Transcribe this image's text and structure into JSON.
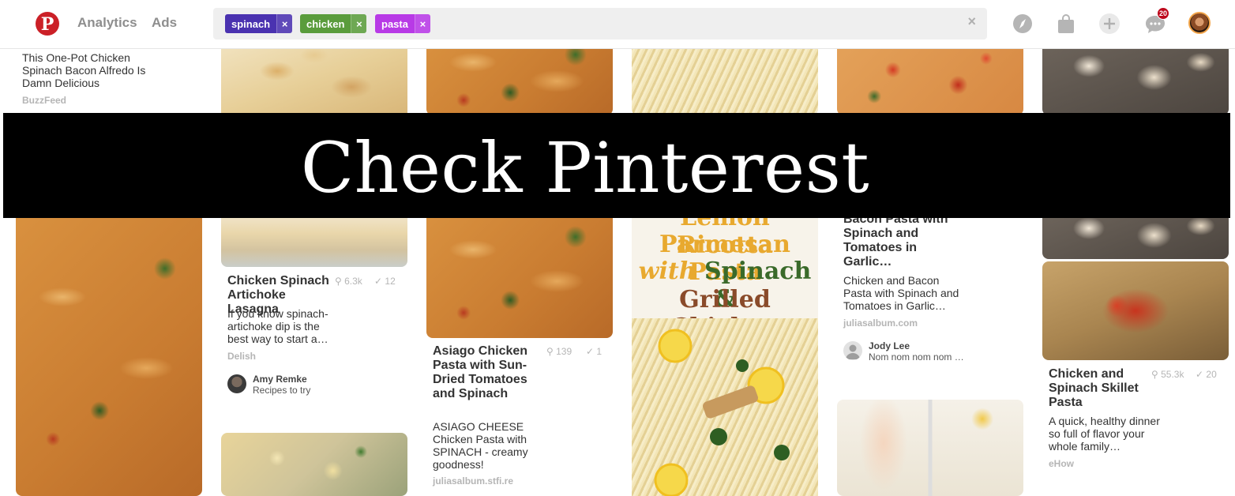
{
  "header": {
    "logo_glyph": "P",
    "nav": {
      "analytics": "Analytics",
      "ads": "Ads"
    },
    "search": {
      "chips": [
        {
          "label": "spinach",
          "remove": "×",
          "color": "#4a32b0"
        },
        {
          "label": "chicken",
          "remove": "×",
          "color": "#5a9c3c"
        },
        {
          "label": "pasta",
          "remove": "×",
          "color": "#b83ae6"
        }
      ],
      "clear": "×"
    },
    "notifications_count": "20",
    "icons": [
      "compass-icon",
      "shopping-bag-icon",
      "plus-icon",
      "chat-icon",
      "avatar"
    ]
  },
  "banner": {
    "text": "Check Pinterest"
  },
  "pins": {
    "col1_top": {
      "title": "This One-Pot Chicken Spinach Bacon Alfredo Is Damn Delicious",
      "source": "BuzzFeed"
    },
    "lasagna": {
      "title": "Chicken Spinach Artichoke Lasagna",
      "saves": "6.3k",
      "tried": "12",
      "description": "If you know spinach-artichoke dip is the best way to start a…",
      "source": "Delish",
      "user": "Amy Remke",
      "board": "Recipes to try"
    },
    "asiago": {
      "title": "Asiago Chicken Pasta with Sun-Dried Tomatoes and Spinach",
      "saves": "139",
      "tried": "1",
      "description": "ASIAGO CHEESE Chicken Pasta with SPINACH - creamy goodness!",
      "source": "juliasalbum.stfi.re"
    },
    "lemon": {
      "line1": "Lemon Ricotta",
      "line2": "Parmesan Pasta",
      "line3a": "with",
      "line3b": "Spinach &",
      "line4": "Grilled Chicken"
    },
    "bacon": {
      "title": "Bacon Pasta with Spinach and Tomatoes in Garlic…",
      "description": "Chicken and Bacon Pasta with Spinach and Tomatoes in Garlic…",
      "source": "juliasalbum.com",
      "user": "Jody Lee",
      "board": "Nom nom nom nom …"
    },
    "skillet": {
      "title": "Chicken and Spinach Skillet Pasta",
      "saves": "55.3k",
      "tried": "20",
      "description": "A quick, healthy dinner so full of flavor your whole family…",
      "source": "eHow"
    }
  }
}
